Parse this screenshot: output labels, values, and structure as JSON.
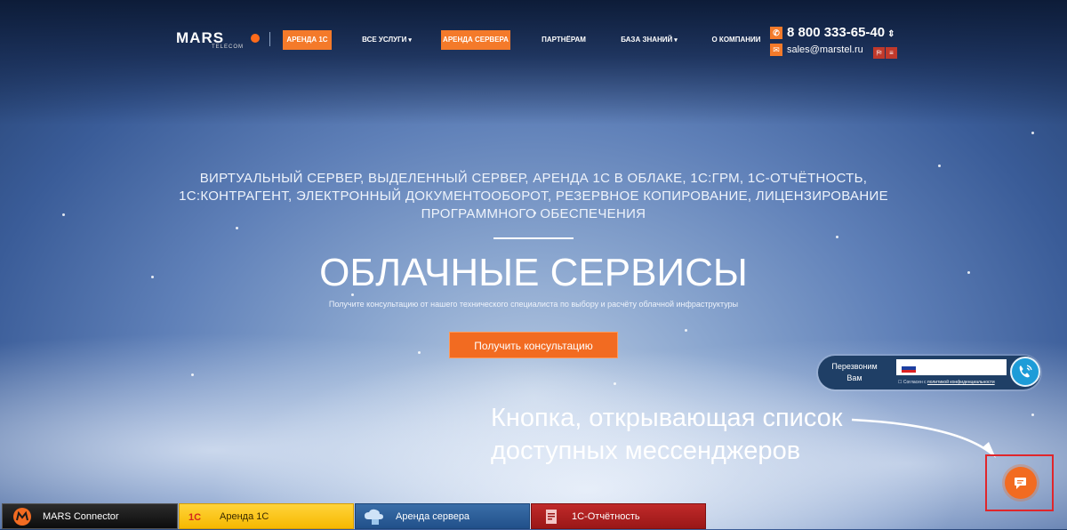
{
  "header": {
    "logo_text": "MARS",
    "logo_sub": "TELECOM",
    "nav": [
      {
        "label": "АРЕНДА 1С"
      },
      {
        "label": "ВСЕ УСЛУГИ"
      },
      {
        "label": "АРЕНДА СЕРВЕРА"
      },
      {
        "label": "ПАРТНЁРАМ"
      },
      {
        "label": "БАЗА ЗНАНИЙ"
      },
      {
        "label": "О КОМПАНИИ"
      }
    ],
    "phone": "8 800 333-65-40",
    "email": "sales@marstel.ru"
  },
  "hero": {
    "services_line1": "ВИРТУАЛЬНЫЙ СЕРВЕР, ВЫДЕЛЕННЫЙ СЕРВЕР, АРЕНДА 1С В ОБЛАКЕ, 1С:ГРМ, 1С-ОТЧЁТНОСТЬ,",
    "services_line2": "1С:КОНТРАГЕНТ, ЭЛЕКТРОННЫЙ ДОКУМЕНТООБОРОТ, РЕЗЕРВНОЕ КОПИРОВАНИЕ, ЛИЦЕНЗИРОВАНИЕ",
    "services_line3": "ПРОГРАММНОГО ОБЕСПЕЧЕНИЯ",
    "title": "ОБЛАЧНЫЕ СЕРВИСЫ",
    "subtitle": "Получите консультацию от нашего технического специалиста по выбору и расчёту облачной инфраструктуры",
    "cta_label": "Получить консультацию"
  },
  "callback": {
    "label_line1": "Перезвоним",
    "label_line2": "Вам",
    "phone_value": "",
    "consent_prefix": "Согласен с",
    "consent_link": "политикой конфиденциальности"
  },
  "annotation": {
    "line1": "Кнопка, открывающая список",
    "line2": "доступных мессенджеров"
  },
  "bottom_bar": [
    {
      "label": "MARS Connector"
    },
    {
      "label": "Аренда 1С"
    },
    {
      "label": "Аренда сервера"
    },
    {
      "label": "1С-Отчётность"
    }
  ],
  "colors": {
    "accent": "#f26b21",
    "callout": "#e0262b",
    "widget": "#1f3f66"
  },
  "icons": [
    "phone-icon",
    "mail-icon",
    "map-icon",
    "menu-icon",
    "sort-arrows-icon",
    "call-icon",
    "chat-icon",
    "flag-ru-icon"
  ]
}
